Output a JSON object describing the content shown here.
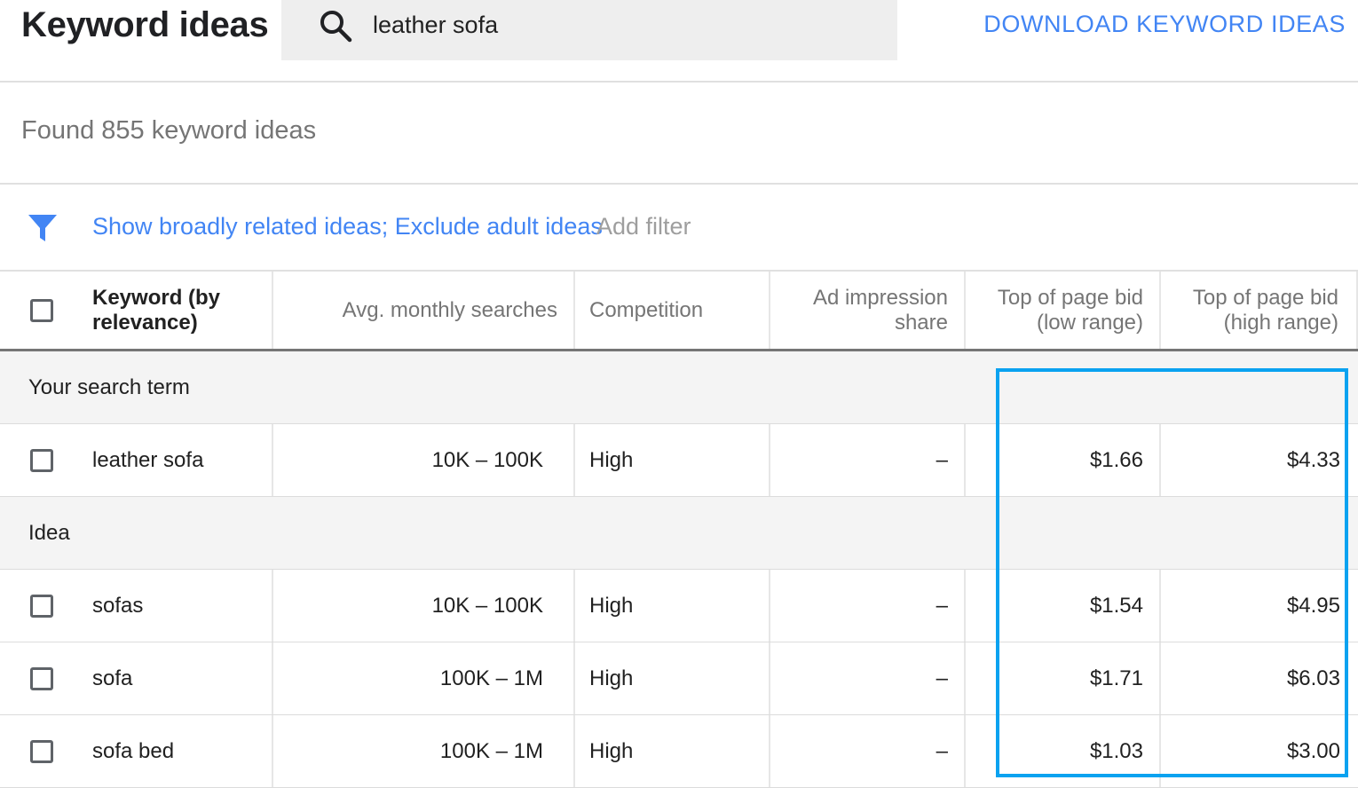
{
  "header": {
    "title": "Keyword ideas",
    "search_value": "leather sofa",
    "search_icon": "search-icon",
    "download_label": "DOWNLOAD KEYWORD IDEAS"
  },
  "found_text": "Found 855 keyword ideas",
  "filters": {
    "icon": "filter-icon",
    "active_label": "Show broadly related ideas; Exclude adult ideas",
    "add_label": "Add filter"
  },
  "table": {
    "columns": {
      "keyword": "Keyword (by relevance)",
      "searches": "Avg. monthly searches",
      "competition": "Competition",
      "impression": "Ad impression share",
      "bid_low": "Top of page bid (low range)",
      "bid_high": "Top of page bid (high range)"
    },
    "search_term_group": "Your search term",
    "idea_group": "Idea",
    "search_term_rows": [
      {
        "keyword": "leather sofa",
        "searches": "10K – 100K",
        "competition": "High",
        "impression": "–",
        "bid_low": "$1.66",
        "bid_high": "$4.33"
      }
    ],
    "idea_rows": [
      {
        "keyword": "sofas",
        "searches": "10K – 100K",
        "competition": "High",
        "impression": "–",
        "bid_low": "$1.54",
        "bid_high": "$4.95"
      },
      {
        "keyword": "sofa",
        "searches": "100K – 1M",
        "competition": "High",
        "impression": "–",
        "bid_low": "$1.71",
        "bid_high": "$6.03"
      },
      {
        "keyword": "sofa bed",
        "searches": "100K – 1M",
        "competition": "High",
        "impression": "–",
        "bid_low": "$1.03",
        "bid_high": "$3.00"
      }
    ]
  },
  "colors": {
    "link": "#4285f4",
    "highlight": "#0aa2f0",
    "muted_text": "#757575",
    "search_bg": "#eeeeee"
  }
}
